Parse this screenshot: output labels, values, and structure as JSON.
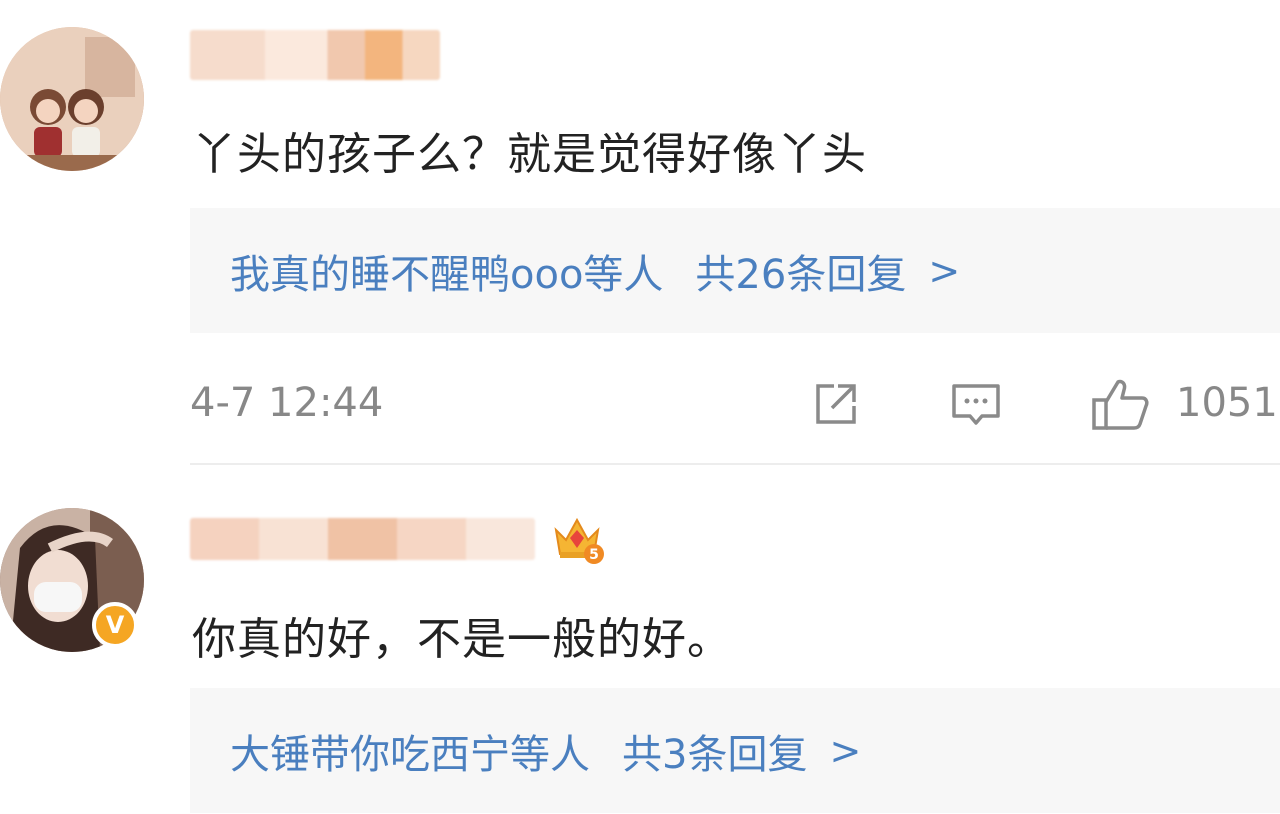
{
  "comments": [
    {
      "text": "丫头的孩子么？就是觉得好像丫头",
      "reply_users": "我真的睡不醒鸭ooo等人",
      "reply_count_label": "共26条回复",
      "chevron": ">",
      "timestamp": "4-7 12:44",
      "like_count": "1051"
    },
    {
      "text": "你真的好，不是一般的好。",
      "reply_users": "大锤带你吃西宁等人",
      "reply_count_label": "共3条回复",
      "chevron": ">",
      "verified_badge": "V",
      "vip_level": "5"
    }
  ],
  "colors": {
    "link": "#4a7fbf",
    "meta_gray": "#888888",
    "reply_bg": "#f7f7f7",
    "verified": "#f5a623"
  }
}
